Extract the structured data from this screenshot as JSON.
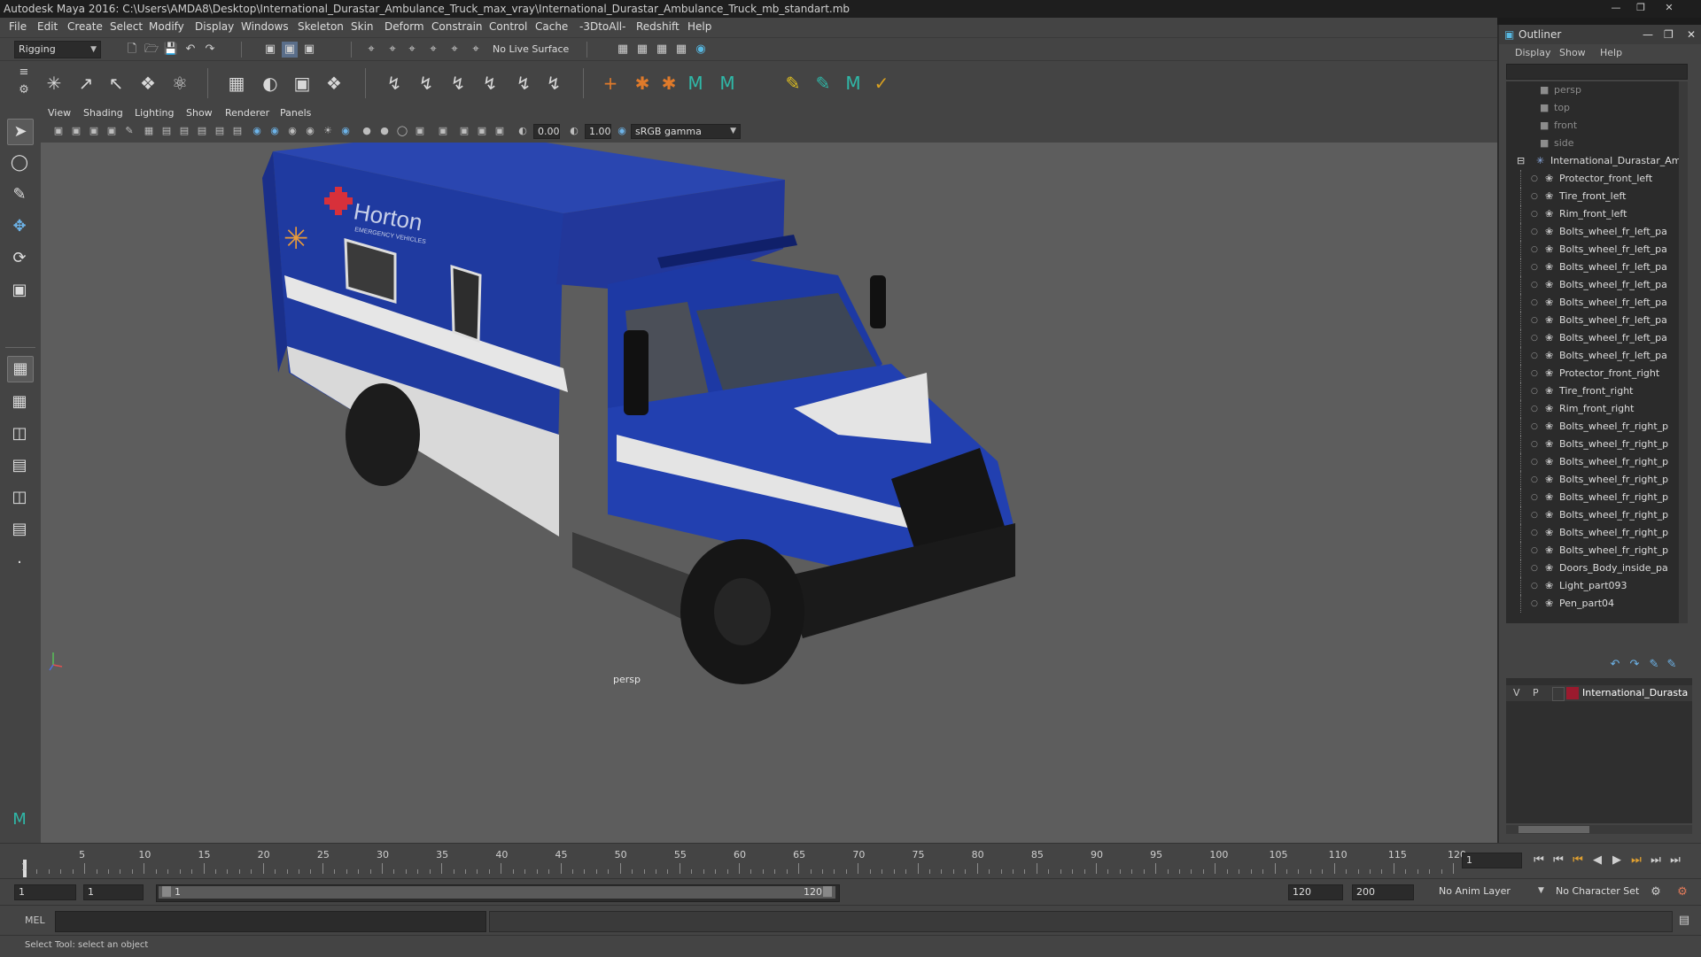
{
  "window": {
    "title": "Autodesk Maya 2016: C:\\Users\\AMDA8\\Desktop\\International_Durastar_Ambulance_Truck_max_vray\\International_Durastar_Ambulance_Truck_mb_standart.mb"
  },
  "menubar": [
    "File",
    "Edit",
    "Create",
    "Select",
    "Modify",
    "Display",
    "Windows",
    "Skeleton",
    "Skin",
    "Deform",
    "Constrain",
    "Control",
    "Cache",
    "-3DtoAll-",
    "Redshift",
    "Help"
  ],
  "statusline": {
    "mode": "Rigging",
    "live_surface": "No Live Surface"
  },
  "panel": {
    "menu": [
      "View",
      "Shading",
      "Lighting",
      "Show",
      "Renderer",
      "Panels"
    ],
    "exposure": "0.00",
    "gamma": "1.00",
    "color_space": "sRGB gamma",
    "camera_label": "persp"
  },
  "truck": {
    "brand": "Horton",
    "subtitle": "EMERGENCY VEHICLES"
  },
  "outliner": {
    "title": "Outliner",
    "menu": [
      "Display",
      "Show",
      "Help"
    ],
    "cameras": [
      "persp",
      "top",
      "front",
      "side"
    ],
    "root": "International_Durastar_Am",
    "children": [
      "Protector_front_left",
      "Tire_front_left",
      "Rim_front_left",
      "Bolts_wheel_fr_left_pa",
      "Bolts_wheel_fr_left_pa",
      "Bolts_wheel_fr_left_pa",
      "Bolts_wheel_fr_left_pa",
      "Bolts_wheel_fr_left_pa",
      "Bolts_wheel_fr_left_pa",
      "Bolts_wheel_fr_left_pa",
      "Bolts_wheel_fr_left_pa",
      "Protector_front_right",
      "Tire_front_right",
      "Rim_front_right",
      "Bolts_wheel_fr_right_p",
      "Bolts_wheel_fr_right_p",
      "Bolts_wheel_fr_right_p",
      "Bolts_wheel_fr_right_p",
      "Bolts_wheel_fr_right_p",
      "Bolts_wheel_fr_right_p",
      "Bolts_wheel_fr_right_p",
      "Bolts_wheel_fr_right_p",
      "Doors_Body_inside_pa",
      "Light_part093",
      "Pen_part04"
    ]
  },
  "layers": {
    "v": "V",
    "p": "P",
    "name": "International_Durastar",
    "color": "#9b1a2e"
  },
  "timeline": {
    "ticks": [
      "5",
      "10",
      "15",
      "20",
      "25",
      "30",
      "35",
      "40",
      "45",
      "50",
      "55",
      "60",
      "65",
      "70",
      "75",
      "80",
      "85",
      "90",
      "95",
      "100",
      "105",
      "110",
      "115",
      "120"
    ],
    "start_marker": "1",
    "current_frame": "1"
  },
  "range": {
    "start": "1",
    "playback_start": "1",
    "slider_start": "1",
    "slider_end": "120",
    "playback_end": "120",
    "end": "200",
    "anim_layer": "No Anim Layer",
    "character_set": "No Character Set"
  },
  "cmd": {
    "label": "MEL"
  },
  "help": {
    "text": "Select Tool: select an object"
  },
  "colors": {
    "truck_blue": "#1f3aa0",
    "viewport_bg": "#5d5d5d",
    "panel_bg": "#444444"
  }
}
